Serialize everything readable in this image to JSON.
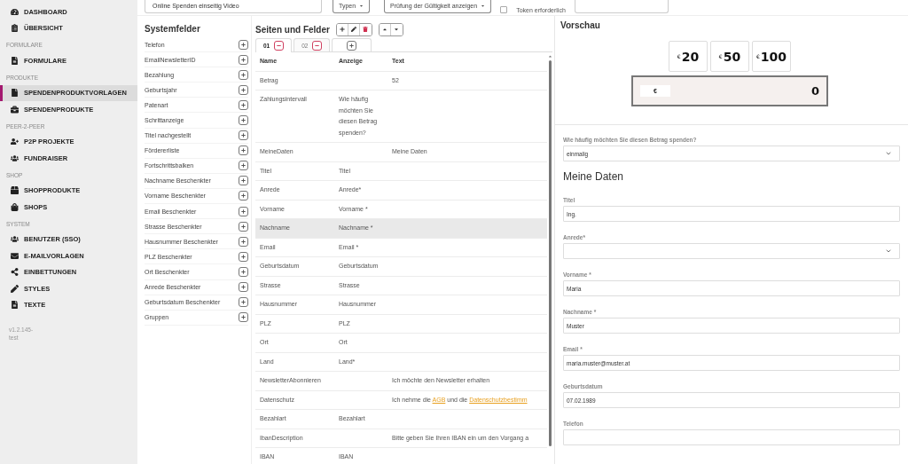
{
  "topbar": {
    "name_field": {
      "value": "Online Spenden einseitig Video"
    },
    "dropdowns": [
      "Typen",
      "Prüfung der Gültigkeit anzeigen"
    ],
    "token": {
      "label": "Token erforderlich",
      "checked": false
    }
  },
  "sidebar": {
    "sections": [
      {
        "items": [
          {
            "label": "DASHBOARD",
            "selected": false
          },
          {
            "label": "ÜBERSICHT",
            "selected": false
          }
        ]
      },
      {
        "title": "FORMULARE",
        "items": [
          {
            "label": "FORMULARE",
            "selected": false
          }
        ]
      },
      {
        "title": "PRODUKTE",
        "items": [
          {
            "label": "SPENDENPRODUKTVORLAGEN",
            "selected": true
          },
          {
            "label": "SPENDENPRODUKTE",
            "selected": false
          }
        ]
      },
      {
        "title": "PEER-2-PEER",
        "items": [
          {
            "label": "P2P PROJEKTE",
            "selected": false
          },
          {
            "label": "FUNDRAISER",
            "selected": false
          }
        ]
      },
      {
        "title": "SHOP",
        "items": [
          {
            "label": "SHOPPRODUKTE",
            "selected": false
          },
          {
            "label": "SHOPS",
            "selected": false
          }
        ]
      },
      {
        "title": "SYSTEM",
        "items": [
          {
            "label": "BENUTZER (SSO)",
            "selected": false
          },
          {
            "label": "E-MAILVORLAGEN",
            "selected": false
          },
          {
            "label": "EINBETTUNGEN",
            "selected": false
          },
          {
            "label": "STYLES",
            "selected": false
          },
          {
            "label": "TEXTE",
            "selected": false
          }
        ]
      }
    ],
    "version": "v1.2.145-test"
  },
  "systemfelder": {
    "title": "Systemfelder",
    "items": [
      "Telefon",
      "EmailNewsletterID",
      "Bezahlung",
      "Geburtsjahr",
      "Patenart",
      "Schrittanzeige",
      "Titel nachgestellt",
      "Fördererliste",
      "Fortschrittsbalken",
      "Nachname Beschenkter",
      "Vorname Beschenkter",
      "Email Beschenkter",
      "Strasse Beschenkter",
      "Hausnummer Beschenkter",
      "PLZ Beschenkter",
      "Ort Beschenkter",
      "Anrede Beschenkter",
      "Geburtsdatum Beschenkter",
      "Gruppen"
    ]
  },
  "pages": {
    "title": "Seiten und Felder",
    "tabs": [
      {
        "label": "01",
        "selected": true
      },
      {
        "label": "02",
        "selected": false
      }
    ],
    "columns": [
      "Name",
      "Anzeige",
      "Text"
    ],
    "rows": [
      {
        "name": "Betrag",
        "text": "52",
        "highlighted": false
      },
      {
        "name": "Zahlungsintervall",
        "display": "Wie häufig möchten Sie diesen Betrag spenden?",
        "highlighted": false
      },
      {
        "name": "MeineDaten",
        "text": "Meine Daten",
        "highlighted": false
      },
      {
        "name": "Titel",
        "display": "Titel",
        "highlighted": false
      },
      {
        "name": "Anrede",
        "display": "Anrede*",
        "highlighted": false
      },
      {
        "name": "Vorname",
        "display": "Vorname *",
        "highlighted": false
      },
      {
        "name": "Nachname",
        "display": "Nachname *",
        "highlighted": true
      },
      {
        "name": "Email",
        "display": "Email *",
        "highlighted": false
      },
      {
        "name": "Geburtsdatum",
        "display": "Geburtsdatum",
        "highlighted": false
      },
      {
        "name": "Strasse",
        "display": "Strasse",
        "highlighted": false
      },
      {
        "name": "Hausnummer",
        "display": "Hausnummer",
        "highlighted": false
      },
      {
        "name": "PLZ",
        "display": "PLZ",
        "highlighted": false
      },
      {
        "name": "Ort",
        "display": "Ort",
        "highlighted": false
      },
      {
        "name": "Land",
        "display": "Land*",
        "highlighted": false
      },
      {
        "name": "NewsletterAbonnieren",
        "text": "Ich möchte den Newsletter erhalten",
        "highlighted": false
      },
      {
        "name": "Datenschutz",
        "text_parts": [
          {
            "text": "Ich nehme die ",
            "link": false
          },
          {
            "text": "AGB",
            "link": true
          },
          {
            "text": " und die ",
            "link": false
          },
          {
            "text": "Datenschutzbestimm",
            "link": true
          }
        ],
        "highlighted": false
      },
      {
        "name": "Bezahlart",
        "display": "Bezahlart",
        "highlighted": false
      },
      {
        "name": "IbanDescription",
        "text": "Bitte geben Sie Ihren IBAN ein um den Vorgang a",
        "highlighted": false
      },
      {
        "name": "IBAN",
        "display": "IBAN",
        "highlighted": false
      }
    ]
  },
  "preview": {
    "title": "Vorschau",
    "amounts": [
      {
        "currency": "€",
        "amount": "20"
      },
      {
        "currency": "€",
        "amount": "50"
      },
      {
        "currency": "€",
        "amount": "100"
      }
    ],
    "amount_input": {
      "currency": "€",
      "value": "0"
    },
    "frequency": {
      "label": "Wie häufig möchten Sie diesen Betrag spenden?",
      "value": "einmalig"
    },
    "heading": "Meine Daten",
    "fields": [
      {
        "kind": "input",
        "label": "Titel",
        "value": "Ing."
      },
      {
        "kind": "select",
        "label": "Anrede*"
      },
      {
        "kind": "input",
        "label": "Vorname *",
        "value": "Maria"
      },
      {
        "kind": "input",
        "label": "Nachname *",
        "value": "Muster"
      },
      {
        "kind": "input",
        "label": "Email *",
        "value": "maria.muster@muster.at"
      },
      {
        "kind": "input",
        "label": "Geburtsdatum",
        "value": "07.02.1989"
      },
      {
        "kind": "input",
        "label": "Telefon"
      }
    ]
  }
}
